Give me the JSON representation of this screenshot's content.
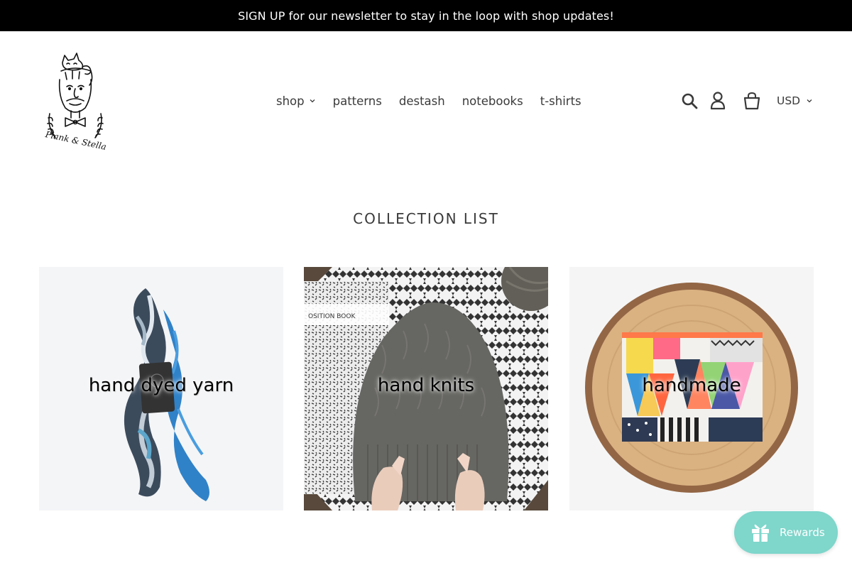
{
  "announcement": {
    "text": "SIGN UP for our newsletter to stay in the loop with shop updates!"
  },
  "brand": {
    "logo_text": "Plank & Stella"
  },
  "nav": {
    "items": [
      {
        "label": "shop",
        "has_dropdown": true
      },
      {
        "label": "patterns"
      },
      {
        "label": "destash"
      },
      {
        "label": "notebooks"
      },
      {
        "label": "t-shirts"
      }
    ]
  },
  "header": {
    "currency": "USD",
    "icons": [
      "search-icon",
      "account-icon",
      "cart-icon"
    ]
  },
  "collection": {
    "title": "COLLECTION LIST",
    "items": [
      {
        "label": "hand dyed yarn"
      },
      {
        "label": "hand knits"
      },
      {
        "label": "handmade"
      }
    ]
  },
  "rewards": {
    "label": "Rewards",
    "color": "#7fd6cb"
  }
}
